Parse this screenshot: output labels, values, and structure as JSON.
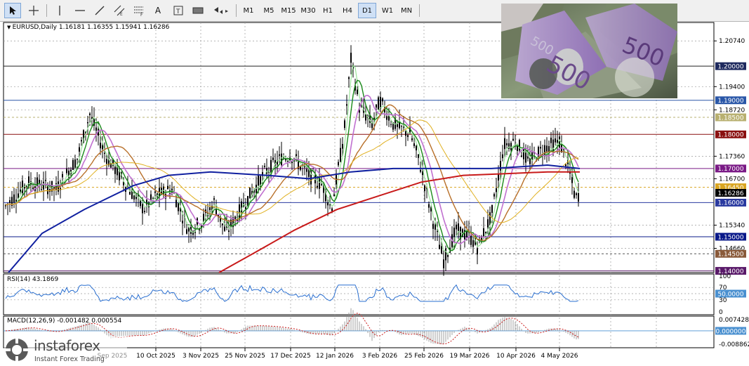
{
  "toolbar": {
    "timeframes": [
      {
        "label": "M1",
        "active": false
      },
      {
        "label": "M5",
        "active": false
      },
      {
        "label": "M15",
        "active": false
      },
      {
        "label": "M30",
        "active": false
      },
      {
        "label": "H1",
        "active": false
      },
      {
        "label": "H4",
        "active": false
      },
      {
        "label": "D1",
        "active": true
      },
      {
        "label": "W1",
        "active": false
      },
      {
        "label": "MN",
        "active": false
      }
    ],
    "tools": [
      "cursor-icon",
      "crosshair-icon",
      "vertical-line-icon",
      "horizontal-line-icon",
      "trend-line-icon",
      "equidistant-channel-icon",
      "fibonacci-icon",
      "text-icon",
      "text-label-icon",
      "rectangle-icon",
      "arrows-icon"
    ]
  },
  "main_chart": {
    "header": "EURUSD,Daily  1.16181 1.16355 1.15941 1.16286",
    "price_labels": [
      "1.20740",
      "1.19400",
      "1.18720",
      "1.17360",
      "1.16700",
      "1.15340",
      "1.14660"
    ],
    "levels": [
      {
        "label": "1.20000",
        "bg": "#1e2a5e"
      },
      {
        "label": "1.19000",
        "bg": "#2a57a8"
      },
      {
        "label": "1.18500",
        "bg": "#b8b070"
      },
      {
        "label": "1.18000",
        "bg": "#8a1010"
      },
      {
        "label": "1.17000",
        "bg": "#7a1a86"
      },
      {
        "label": "1.16450",
        "bg": "#d9a521"
      },
      {
        "label": "1.16286",
        "bg": "#000000"
      },
      {
        "label": "1.16000",
        "bg": "#2a3aa0"
      },
      {
        "label": "1.15000",
        "bg": "#0a1a8a"
      },
      {
        "label": "1.14500",
        "bg": "#8a5a3a"
      },
      {
        "label": "1.14000",
        "bg": "#5a1a6a"
      }
    ]
  },
  "rsi": {
    "header": "RSI(14) 43.1869",
    "labels": [
      "100",
      "70",
      "50.0000",
      "30",
      "0"
    ]
  },
  "macd": {
    "header": "MACD(12,26,9) -0.001482 0.000554",
    "labels": [
      "0.007428",
      "0.000000",
      "-0.008862"
    ]
  },
  "dates": [
    "10 Oct 2025",
    "3 Nov 2025",
    "25 Nov 2025",
    "17 Dec 2025",
    "12 Jan 2026",
    "3 Feb 2026",
    "25 Feb 2026",
    "19 Mar 2026",
    "10 Apr 2026",
    "4 May 2026"
  ],
  "dates_partial": [
    "Sep 2025"
  ],
  "brand": {
    "name": "instaforex",
    "tagline": "Instant Forex Trading"
  },
  "photo": {
    "banknote_denomination": "500"
  },
  "chart_data": {
    "type": "candlestick",
    "symbol": "EURUSD",
    "timeframe": "Daily",
    "last_bar": {
      "open": 1.16181,
      "high": 1.16355,
      "low": 1.15941,
      "close": 1.16286
    },
    "ylim": [
      1.1395,
      1.2128
    ],
    "x": [
      "Sep 2025",
      "10 Oct 2025",
      "3 Nov 2025",
      "25 Nov 2025",
      "17 Dec 2025",
      "12 Jan 2026",
      "3 Feb 2026",
      "25 Feb 2026",
      "19 Mar 2026",
      "10 Apr 2026",
      "4 May 2026"
    ],
    "close_approx": [
      1.169,
      1.162,
      1.153,
      1.16,
      1.174,
      1.164,
      1.184,
      1.176,
      1.15,
      1.178,
      1.1629
    ],
    "horizontal_levels": [
      1.2,
      1.19,
      1.185,
      1.18,
      1.17,
      1.1645,
      1.16,
      1.15,
      1.145,
      1.14
    ],
    "indicators": [
      {
        "name": "RSI(14)",
        "value": 43.1869,
        "levels": [
          30,
          50,
          70
        ],
        "ylim": [
          0,
          100
        ]
      },
      {
        "name": "MACD(12,26,9)",
        "main": -0.001482,
        "signal": 0.000554,
        "ylim": [
          -0.008862,
          0.007428
        ]
      }
    ],
    "grid": "dashed"
  }
}
